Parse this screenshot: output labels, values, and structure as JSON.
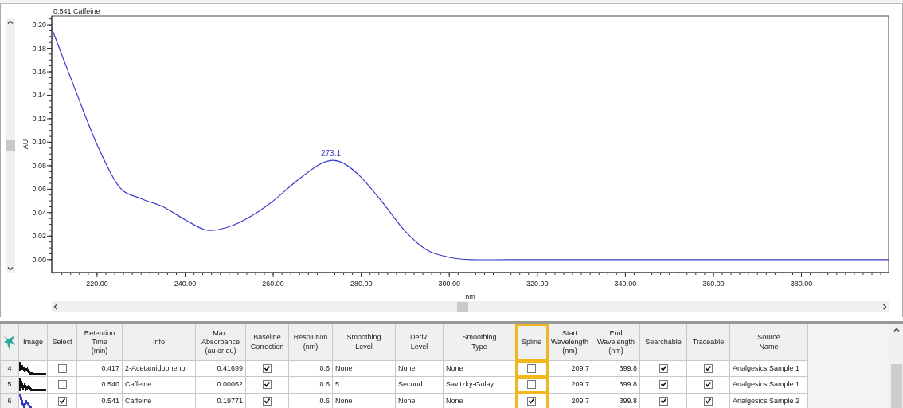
{
  "chart_panel": {
    "chart_data": {
      "type": "line",
      "xlabel": "nm",
      "ylabel": "AU",
      "xlim": [
        209.7,
        399.8
      ],
      "ylim": [
        -0.011,
        0.2075
      ],
      "xticks": [
        {
          "value": 220,
          "label": "220.00"
        },
        {
          "value": 240,
          "label": "240.00"
        },
        {
          "value": 260,
          "label": "260.00"
        },
        {
          "value": 280,
          "label": "280.00"
        },
        {
          "value": 300,
          "label": "300.00"
        },
        {
          "value": 320,
          "label": "320.00"
        },
        {
          "value": 340,
          "label": "340.00"
        },
        {
          "value": 360,
          "label": "360.00"
        },
        {
          "value": 380,
          "label": "380.00"
        }
      ],
      "yticks": [
        {
          "value": 0,
          "label": "0.00"
        },
        {
          "value": 0.02,
          "label": "0.02"
        },
        {
          "value": 0.04,
          "label": "0.04"
        },
        {
          "value": 0.06,
          "label": "0.06"
        },
        {
          "value": 0.08,
          "label": "0.08"
        },
        {
          "value": 0.1,
          "label": "0.10"
        },
        {
          "value": 0.12,
          "label": "0.12"
        },
        {
          "value": 0.14,
          "label": "0.14"
        },
        {
          "value": 0.16,
          "label": "0.16"
        },
        {
          "value": 0.18,
          "label": "0.18"
        },
        {
          "value": 0.2,
          "label": "0.20"
        }
      ],
      "x": [
        209.7,
        215,
        220,
        225,
        230,
        235,
        240,
        245,
        250,
        255,
        260,
        265,
        270,
        273.1,
        276,
        280,
        285,
        290,
        295,
        300,
        305,
        320,
        340,
        360,
        380,
        399.8
      ],
      "series": [
        {
          "name": "0.541 Caffeine",
          "color": "#3a3ac8",
          "values": [
            0.197,
            0.145,
            0.098,
            0.062,
            0.052,
            0.045,
            0.034,
            0.025,
            0.028,
            0.037,
            0.05,
            0.066,
            0.08,
            0.0845,
            0.082,
            0.07,
            0.048,
            0.024,
            0.008,
            0.002,
            0.0,
            0.0,
            0.0,
            0.0,
            0.0,
            0.0
          ]
        }
      ],
      "annotations": [
        {
          "x": 273.1,
          "y": 0.0845,
          "text": "273.1"
        }
      ]
    }
  },
  "table": {
    "columns": [
      {
        "label": "Image",
        "kind": "image",
        "highlighted": false
      },
      {
        "label": "Select",
        "kind": "check",
        "highlighted": false
      },
      {
        "label": "Retention\nTime\n(min)",
        "kind": "number",
        "highlighted": false
      },
      {
        "label": "Info",
        "kind": "text",
        "highlighted": false
      },
      {
        "label": "Max.\nAbsorbance\n(au or eu)",
        "kind": "number",
        "highlighted": false
      },
      {
        "label": "Baseline\nCorrection",
        "kind": "check",
        "highlighted": false
      },
      {
        "label": "Resolution\n(nm)",
        "kind": "number",
        "highlighted": false
      },
      {
        "label": "Smoothing\nLevel",
        "kind": "text",
        "highlighted": false
      },
      {
        "label": "Deriv.\nLevel",
        "kind": "text",
        "highlighted": false
      },
      {
        "label": "Smoothing\nType",
        "kind": "text",
        "highlighted": false
      },
      {
        "label": "Spline",
        "kind": "check",
        "highlighted": true
      },
      {
        "label": "Start\nWavelength\n(nm)",
        "kind": "number",
        "highlighted": false
      },
      {
        "label": "End\nWavelength\n(nm)",
        "kind": "number",
        "highlighted": false
      },
      {
        "label": "Searchable",
        "kind": "check",
        "highlighted": false
      },
      {
        "label": "Traceable",
        "kind": "check",
        "highlighted": false
      },
      {
        "label": "Source\nName",
        "kind": "text",
        "highlighted": false
      }
    ],
    "rows": [
      {
        "number": "4",
        "cells": [
          {
            "kind": "picture",
            "color": "#111111"
          },
          {
            "checked": false
          },
          {
            "text": "0.417"
          },
          {
            "text": "2-Acetamidophenol"
          },
          {
            "text": "0.41699"
          },
          {
            "checked": true
          },
          {
            "text": "0.6"
          },
          {
            "text": "None"
          },
          {
            "text": "None"
          },
          {
            "text": "None"
          },
          {
            "checked": false
          },
          {
            "text": "209.7"
          },
          {
            "text": "399.8"
          },
          {
            "checked": true
          },
          {
            "checked": true
          },
          {
            "text": "Analgesics Sample 1"
          }
        ]
      },
      {
        "number": "5",
        "cells": [
          {
            "kind": "picture",
            "color": "#111111"
          },
          {
            "checked": false
          },
          {
            "text": "0.540"
          },
          {
            "text": "Caffeine"
          },
          {
            "text": "0.00062"
          },
          {
            "checked": true
          },
          {
            "text": "0.6"
          },
          {
            "text": "5"
          },
          {
            "text": "Second"
          },
          {
            "text": "Savitzky-Golay"
          },
          {
            "checked": false
          },
          {
            "text": "209.7"
          },
          {
            "text": "399.8"
          },
          {
            "checked": true
          },
          {
            "checked": true
          },
          {
            "text": "Analgesics Sample 1"
          }
        ]
      },
      {
        "number": "6",
        "cells": [
          {
            "kind": "picture",
            "color": "#3a3ac8"
          },
          {
            "checked": true
          },
          {
            "text": "0.541"
          },
          {
            "text": "Caffeine"
          },
          {
            "text": "0.19771"
          },
          {
            "checked": true
          },
          {
            "text": "0.6"
          },
          {
            "text": "None"
          },
          {
            "text": "None"
          },
          {
            "text": "None"
          },
          {
            "checked": true
          },
          {
            "text": "209.7"
          },
          {
            "text": "399.8"
          },
          {
            "checked": true
          },
          {
            "checked": true
          },
          {
            "text": "Analgesics Sample 2"
          }
        ]
      }
    ]
  }
}
